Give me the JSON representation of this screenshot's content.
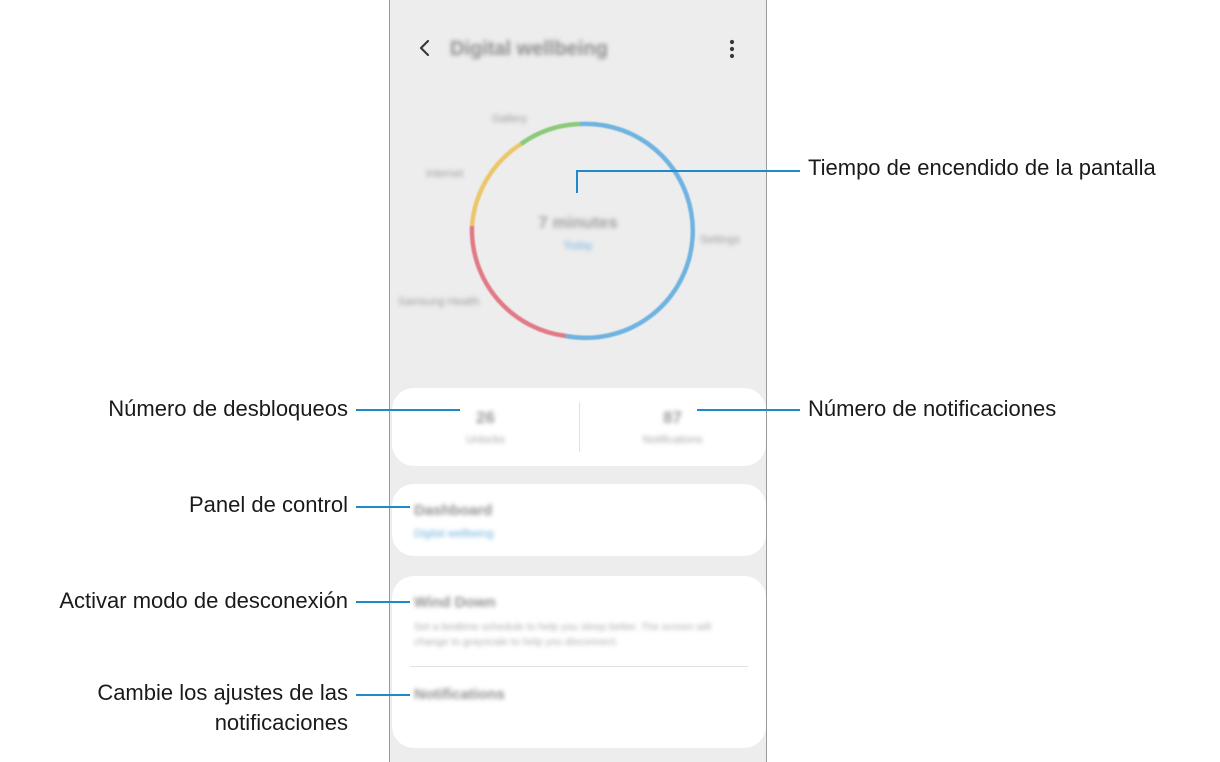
{
  "app": {
    "title": "Digital wellbeing"
  },
  "icons": {
    "back": "chevron-left-icon",
    "more": "more-vertical-icon"
  },
  "colors": {
    "ring_blue": "#6fb3e0",
    "ring_red": "#e07b86",
    "ring_yellow": "#ecc66a",
    "ring_green": "#8cc97a",
    "callout_line": "#1f8ac9"
  },
  "usage_ring": {
    "center_value": "7 minutes",
    "center_sub": "Today",
    "labels": {
      "top": "Gallery",
      "upper_left": "Internet",
      "right": "Settings",
      "lower_left": "Samsung Health"
    }
  },
  "stats": {
    "unlocks_value": "26",
    "unlocks_label": "Unlocks",
    "notifications_value": "87",
    "notifications_label": "Notifications"
  },
  "dashboard": {
    "title": "Dashboard",
    "subtitle": "Digital wellbeing"
  },
  "wind_down": {
    "title": "Wind Down",
    "description": "Set a bedtime schedule to help you sleep better. The screen will change to grayscale to help you disconnect."
  },
  "notifications_setting": {
    "title": "Notifications"
  },
  "callouts": {
    "screen_time": "Tiempo de encendido de la pantalla",
    "unlocks": "Número de desbloqueos",
    "notifications_count": "Número de notificaciones",
    "dashboard": "Panel de control",
    "wind_down": "Activar modo de desconexión",
    "notifications_line1": "Cambie los ajustes de las",
    "notifications_line2": "notificaciones"
  }
}
